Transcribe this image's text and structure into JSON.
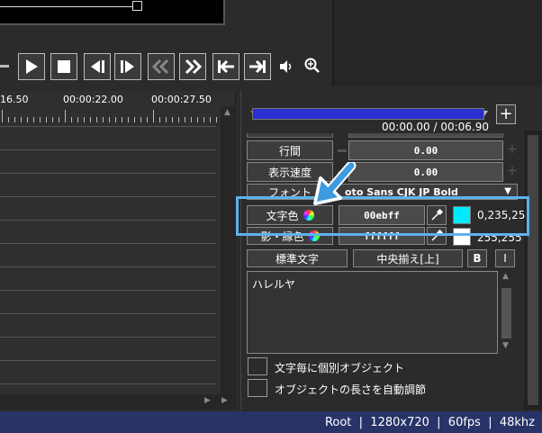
{
  "timeline": {
    "time_labels": [
      "16.50",
      "00:00:22.00",
      "00:00:27.50"
    ]
  },
  "transport": {
    "buttons": [
      "play-icon",
      "stop-icon",
      "prev-frame-icon",
      "next-frame-icon",
      "rewind-icon",
      "fast-forward-icon",
      "jump-start-icon",
      "jump-end-icon",
      "volume-icon",
      "zoom-icon"
    ]
  },
  "panel": {
    "time_display": "00:00.00 / 00:06.90",
    "add_label": "+",
    "line_spacing": {
      "label": "行間",
      "value": "0.00"
    },
    "display_speed": {
      "label": "表示速度",
      "value": "0.00"
    },
    "font": {
      "label": "フォント",
      "value": "oto Sans CJK JP Bold"
    },
    "text_color": {
      "label": "文字色",
      "hex": "00ebff",
      "rgb": "0,235,25",
      "swatch": "#00ebff"
    },
    "shadow_color": {
      "label": "影・縁色",
      "hex": "ffffff",
      "rgb": "255,255",
      "swatch": "#ffffff"
    },
    "buttons": {
      "standard_text": "標準文字",
      "align": "中央揃え[上]",
      "bold": "B",
      "italic": "I"
    },
    "text_content": "ハレルヤ",
    "checkboxes": [
      "文字毎に個別オブジェクト",
      "オブジェクトの長さを自動調節"
    ]
  },
  "status_bar": {
    "text": "Root  |  1280x720  |  60fps  |  48khz"
  },
  "colors": {
    "seekbar": "#2a2fd0",
    "highlight": "#5bb3ec",
    "statusbar": "#283368"
  }
}
